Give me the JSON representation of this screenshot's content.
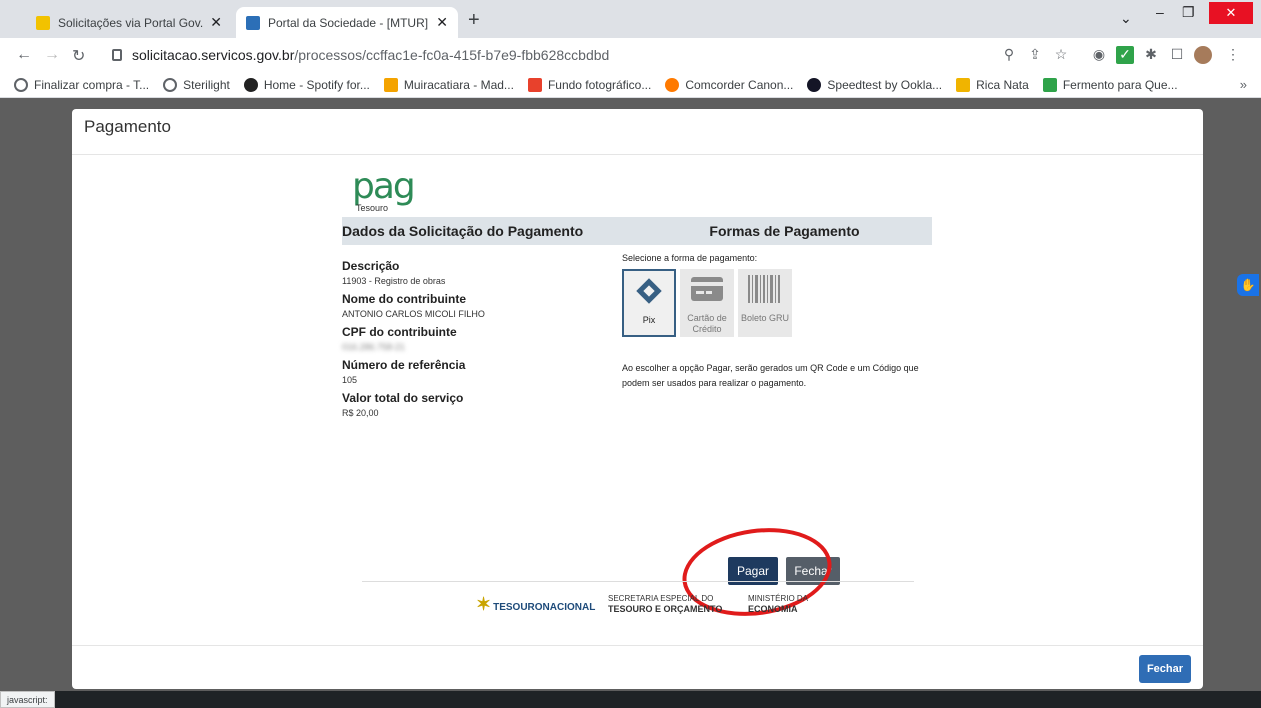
{
  "browser": {
    "tabs": [
      {
        "title": "Solicitações via Portal Gov.Br — F",
        "active": false
      },
      {
        "title": "Portal da Sociedade - [MTUR] Re",
        "active": true
      }
    ],
    "new_tab": "+",
    "address": {
      "host": "solicitacao.servicos.gov.br",
      "path": "/processos/ccffac1e-fc0a-415f-b7e9-fbb628ccbdbd"
    },
    "bookmarks": [
      {
        "label": "Finalizar compra - T...",
        "color": "#5f6368"
      },
      {
        "label": "Sterilight",
        "color": "#5f6368"
      },
      {
        "label": "Home - Spotify for...",
        "color": "#222222"
      },
      {
        "label": "Muiracatiara - Mad...",
        "color": "#f4a300"
      },
      {
        "label": "Fundo fotográfico...",
        "color": "#e8412c"
      },
      {
        "label": "Comcorder Canon...",
        "color": "#ff7a00"
      },
      {
        "label": "Speedtest by Ookla...",
        "color": "#141526"
      },
      {
        "label": "Rica Nata",
        "color": "#f0b400"
      },
      {
        "label": "Fermento para Que...",
        "color": "#2fa34a"
      }
    ],
    "bookmarks_more": "»",
    "status": "javascript:"
  },
  "modal": {
    "title": "Pagamento",
    "footer_close": "Fechar",
    "logo": {
      "word": "pag",
      "sub": "Tesouro"
    },
    "left_heading": "Dados da Solicitação do Pagamento",
    "right_heading": "Formas de Pagamento",
    "fields": [
      {
        "label": "Descrição",
        "value": "11903 - Registro de obras"
      },
      {
        "label": "Nome do contribuinte",
        "value": "ANTONIO CARLOS MICOLI FILHO"
      },
      {
        "label": "CPF do contribuinte",
        "value": "016.286.758-21"
      },
      {
        "label": "Número de referência",
        "value": "105"
      },
      {
        "label": "Valor total do serviço",
        "value": "R$ 20,00"
      }
    ],
    "select_label": "Selecione a forma de pagamento:",
    "pay_options": [
      {
        "label": "Pix",
        "selected": true
      },
      {
        "label": "Cartão de Crédito",
        "selected": false
      },
      {
        "label": "Boleto GRU",
        "selected": false
      }
    ],
    "note": "Ao escolher a opção Pagar, serão gerados um QR Code e um Código que podem ser usados para realizar o pagamento.",
    "pay_button": "Pagar",
    "close_button": "Fechar",
    "logos": {
      "tesouro": "TESOURONACIONAL",
      "secretaria_line1": "SECRETARIA ESPECIAL DO",
      "secretaria_line2": "TESOURO E ORÇAMENTO",
      "ministerio_line1": "MINISTÉRIO DA",
      "ministerio_line2": "ECONOMIA"
    }
  },
  "colors": {
    "pix": "#32bcad",
    "primary": "#1e3a5f",
    "annotation": "#e01b1b"
  }
}
